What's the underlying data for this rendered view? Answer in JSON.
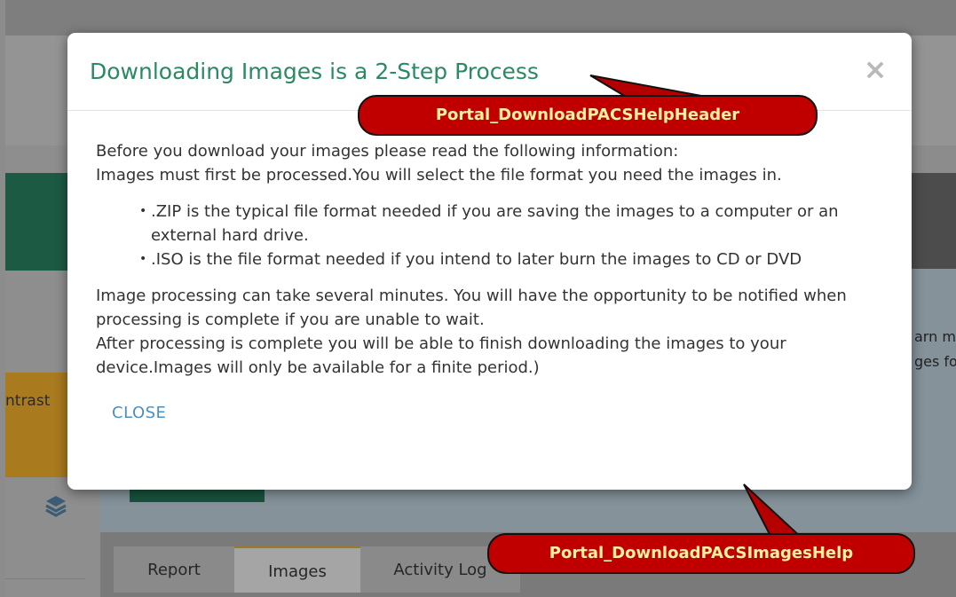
{
  "background": {
    "contrast_label": "ntrast",
    "right_text_1": "arn m",
    "right_text_2": "ges fo",
    "tabs": [
      {
        "label": "Report"
      },
      {
        "label": "Images"
      },
      {
        "label": "Activity Log"
      }
    ],
    "active_tab": "Images",
    "layers_icon": "layers-icon"
  },
  "modal": {
    "title": "Downloading Images is a 2-Step Process",
    "close_icon": "close-icon",
    "close_glyph": "×",
    "intro_1": "Before you download your images please read the following information:",
    "intro_2": "Images must first be processed.You will select the file format you need the images in.",
    "bullets": [
      ".ZIP is the typical file format needed if you are saving the images to a computer or an external hard drive.",
      ".ISO is the file format needed if you intend to later burn the images to CD or DVD"
    ],
    "para_1": "Image processing can take several minutes. You will have the opportunity to be notified when processing is complete if you are unable to wait.",
    "para_2": "After processing is complete you will be able to finish downloading the images to your device.Images will only be available for a finite period.)",
    "close_label": "CLOSE"
  },
  "annotations": {
    "header_callout": "Portal_DownloadPACSHelpHeader",
    "body_callout": "Portal_DownloadPACSImagesHelp"
  },
  "colors": {
    "title_green": "#2b8a62",
    "close_link_blue": "#4a90c2",
    "callout_red": "#c00000",
    "callout_text": "#fff2a0"
  }
}
